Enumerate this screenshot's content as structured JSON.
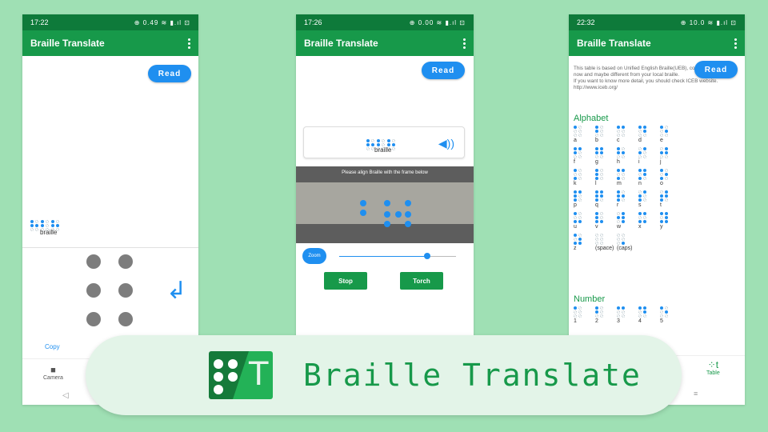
{
  "colors": {
    "background": "#9fe0b4",
    "appbar": "#17994a",
    "statusbar": "#0e7a3a",
    "accent": "#1f8ff0"
  },
  "screen1": {
    "status_time": "17:22",
    "status_icons": "⊕ 0.49 ≋ ▮.ıl ⊡",
    "app_title": "Braille Translate",
    "read_label": "Read",
    "word_label": "braille",
    "copy_label": "Copy",
    "nav_camera_label": "Camera",
    "nav_camera_icon": "camera-icon",
    "enter_icon": "enter-arrow-icon"
  },
  "screen2": {
    "status_time": "17:26",
    "status_icons": "⊕ 0.00 ≋ ▮.ıl ⊡",
    "app_title": "Braille Translate",
    "read_label": "Read",
    "word_label": "braille",
    "align_text": "Please align Braille with the frame below",
    "zoom_label": "Zoom",
    "zoom_level": 0.75,
    "stop_label": "Stop",
    "torch_label": "Torch"
  },
  "screen3": {
    "status_time": "22:32",
    "status_icons": "⊕ 10.0 ≋ ▮.ıl ⊡",
    "app_title": "Braille Translate",
    "read_label": "Read",
    "info_text_1": "This table is based on Unified English Braille(UEB), covers only Grade 1 now and maybe different from your local braille.",
    "info_text_2": "If you want to know more detail, you should check ICEB website.",
    "info_url": "http://www.iceb.org/",
    "alphabet_title": "Alphabet",
    "alphabet": [
      "a",
      "b",
      "c",
      "d",
      "e",
      "f",
      "g",
      "h",
      "i",
      "j",
      "k",
      "l",
      "m",
      "n",
      "o",
      "p",
      "q",
      "r",
      "s",
      "t",
      "u",
      "v",
      "w",
      "x",
      "y",
      "z",
      "(space)",
      "(caps)"
    ],
    "number_title": "Number",
    "numbers": [
      "1",
      "2",
      "3",
      "4",
      "5"
    ],
    "nav_table_label": "Table"
  },
  "banner": {
    "logo_letter": "T",
    "title": "Braille Translate"
  }
}
